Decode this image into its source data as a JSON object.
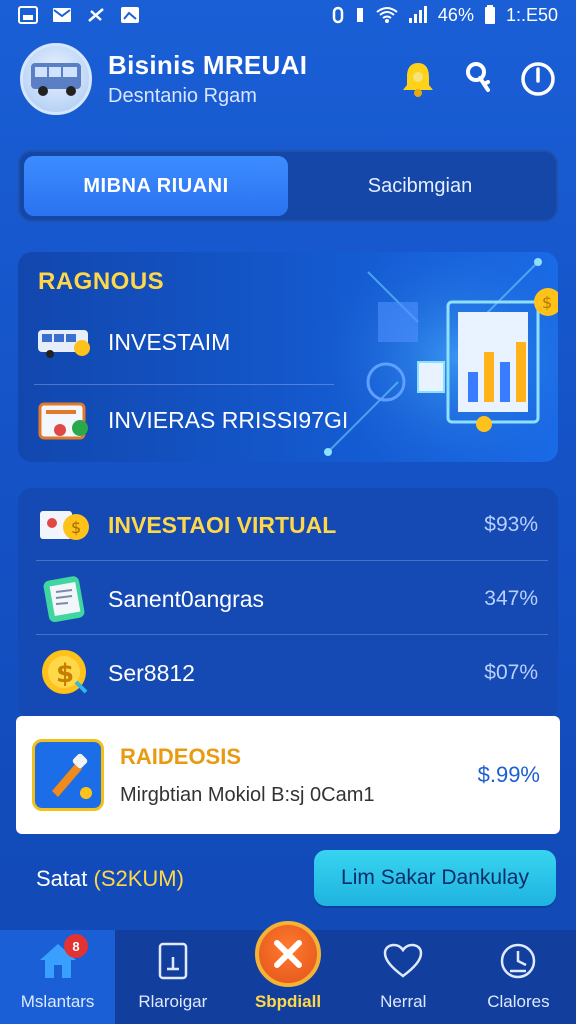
{
  "status_bar": {
    "battery": "46%",
    "time": "1:.E50"
  },
  "header": {
    "title": "Bisinis MREUAI",
    "subtitle": "Desntanio Rgam"
  },
  "tabs": [
    {
      "label": "MIBNA RIUANI",
      "active": true
    },
    {
      "label": "Sacibmgian",
      "active": false
    }
  ],
  "feature": {
    "title": "RAGNOUS",
    "items": [
      {
        "label": "INVESTAIM",
        "icon": "bus-icon"
      },
      {
        "label": "INVIERAS RRISSI97GI",
        "icon": "briefcase-icon"
      }
    ]
  },
  "list": [
    {
      "label": "INVESTAOI VIRTUAL",
      "value": "$93%",
      "icon": "coin-icon",
      "highlight": true
    },
    {
      "label": "Sanent0angras",
      "value": "347%",
      "icon": "document-icon",
      "highlight": false
    },
    {
      "label": "Ser8812",
      "value": "$07%",
      "icon": "dollar-coin-icon",
      "highlight": false
    }
  ],
  "featured_card": {
    "title": "RAIDEOSIS",
    "subtitle": "Mirgbtian Mokiol B:sj 0Cam1",
    "value": "$.99%"
  },
  "footer": {
    "total_prefix": "Satat",
    "total_value": "(S2KUM)",
    "cta": "Lim Sakar Dankulay"
  },
  "bottom_nav": [
    {
      "label": "Mslantars",
      "icon": "home-icon",
      "badge": "8"
    },
    {
      "label": "Rlaroigar",
      "icon": "document-icon"
    },
    {
      "label": "Sbpdiall",
      "icon": "close-icon"
    },
    {
      "label": "Nerral",
      "icon": "heart-icon"
    },
    {
      "label": "Clalores",
      "icon": "clock-icon"
    }
  ],
  "colors": {
    "accent": "#ffd84a",
    "primary": "#1a5fd6",
    "cta": "#2cc8ec"
  }
}
